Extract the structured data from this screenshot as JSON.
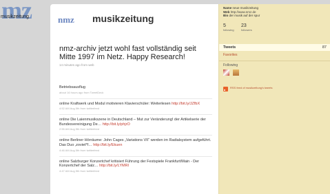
{
  "background": {
    "logo_big": "mz",
    "logo_small": "musikzeitung"
  },
  "header": {
    "logo": "nmz",
    "name": "musikzeitung"
  },
  "latest": {
    "text": "nmz-archiv jetzt wohl fast vollständig seit Mitte 1997 im Netz. Happy Research!",
    "meta": "14 minutes ago from web"
  },
  "tweets": [
    {
      "text": "Betriebsausflug",
      "link": "",
      "meta": "about 16 hours ago from TweetDeck"
    },
    {
      "text": "online Kraftwerk und Modul motivieren Klavierschüler: Weiterlesen",
      "link": "http://bit.ly/JZfbX",
      "meta": "4:52 AM Aug 5th from twitterfeed"
    },
    {
      "text": "online Die Laienmusikszene in Deutschland – Mut zur Veränderung! der Artikelserie der Bundesvereinigung De…",
      "link": "http://bit.ly/phjrO",
      "meta": "2:55 AM Aug 5th from twitterfeed"
    },
    {
      "text": "online Berliner Hörräume: John Cages „Variations VII“ werden im Radialsystem aufgeführt. Das Duo ‚zoviet*f…",
      "link": "http://bit.ly/Ekuen",
      "meta": "4:46 AM Aug 5th from twitterfeed"
    },
    {
      "text": "online Salzburger Konzertchef kritisiert Führung der Festspiele Frankfurt/Main - Der Konzertchef der Salz…",
      "link": "http://bit.ly/LYMRI",
      "meta": "4:47 AM Aug 5th from twitterfeed"
    }
  ],
  "sidebar": {
    "name_label": "Name",
    "name_value": "neue musikzeitung",
    "web_label": "Web",
    "web_value": "http://www.nmz.de",
    "bio_label": "Bio",
    "bio_value": "der musik auf der spur",
    "following_count": "5",
    "following_label": "following",
    "followers_count": "23",
    "followers_label": "followers",
    "tweets_label": "Tweets",
    "tweets_count": "87",
    "favorites_label": "Favorites",
    "following_title": "Following",
    "rss_text": "RSS feed of musikzeitung's tweets"
  },
  "colors": {
    "link": "#c2392b",
    "sidebar_bg": "#f1e7b9",
    "accent": "#6b86c0"
  }
}
